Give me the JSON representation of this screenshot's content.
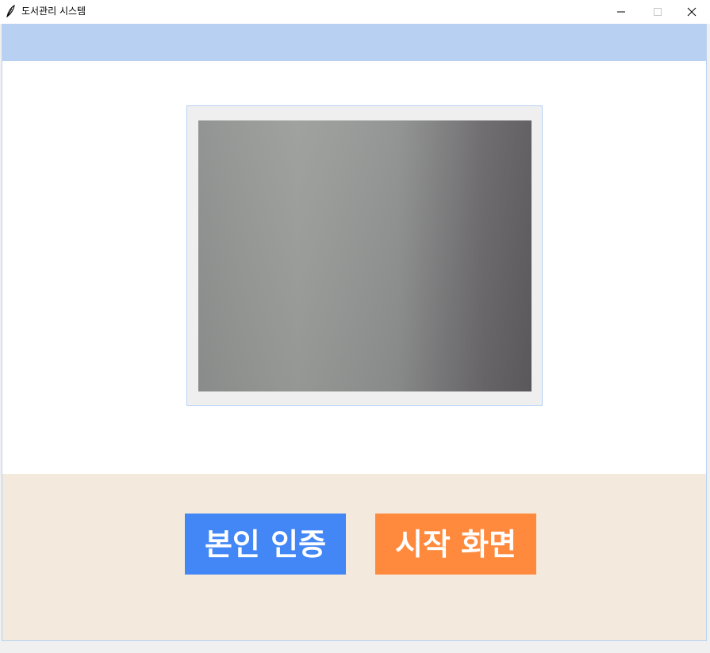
{
  "window": {
    "title": "도서관리 시스템",
    "icon": "feather-icon",
    "controls": {
      "minimize_icon": "minimize-icon",
      "maximize_icon": "maximize-icon",
      "close_icon": "close-icon"
    }
  },
  "colors": {
    "header_band": "#b8d1f3",
    "bottom_panel": "#f3e9dc",
    "verify_button": "#4287f5",
    "home_button": "#ff8a3d",
    "camera_frame_bg": "#efefef"
  },
  "camera": {
    "feed": "live-camera-preview"
  },
  "actions": {
    "verify_label": "본인 인증",
    "home_label": "시작 화면"
  }
}
